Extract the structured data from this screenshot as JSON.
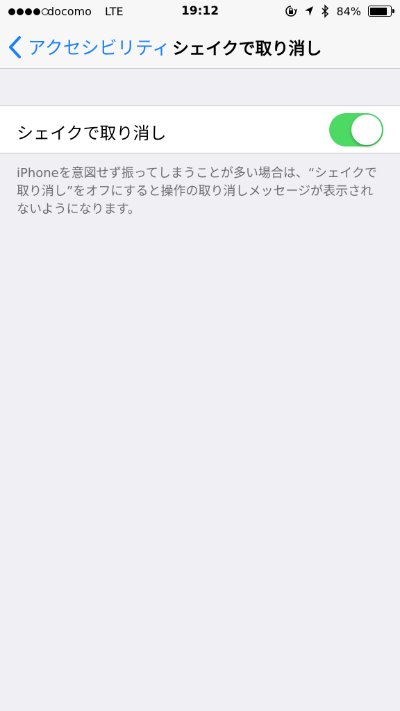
{
  "status_bar": {
    "carrier": "docomo",
    "network": "LTE",
    "time": "19:12",
    "battery_percent": "84%",
    "battery_level": 0.84,
    "icons": [
      "orientation-lock-icon",
      "location-arrow-icon",
      "bluetooth-icon",
      "battery-icon"
    ]
  },
  "nav": {
    "back_label": "アクセシビリティ",
    "title": "シェイクで取り消し"
  },
  "settings": {
    "row_label": "シェイクで取り消し",
    "toggle_on": true
  },
  "footer_note": "iPhoneを意図せず振ってしまうことが多い場合は、“シェイクで取り消し”をオフにすると操作の取り消しメッセージが表示されないようになります。",
  "colors": {
    "accent": "#1a7ffb",
    "toggle_on": "#4cd964",
    "background": "#efeff4"
  }
}
